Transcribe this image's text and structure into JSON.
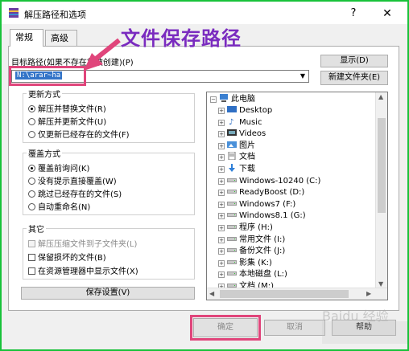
{
  "window": {
    "title": "解压路径和选项",
    "help": "?",
    "close": "✕"
  },
  "tabs": [
    {
      "label": "常规",
      "active": true
    },
    {
      "label": "高级",
      "active": false
    }
  ],
  "annotation": {
    "text": "文件保存路径",
    "color": "#7a2bbf",
    "highlight_color": "#e0457b"
  },
  "path": {
    "label": "目标路径(如果不存在将被创建)(P)",
    "value": "N:\\arar~ha",
    "show_button": "显示(D)",
    "new_folder_button": "新建文件夹(E)"
  },
  "update_mode": {
    "title": "更新方式",
    "options": [
      {
        "label": "解压并替换文件(R)",
        "selected": true
      },
      {
        "label": "解压并更新文件(U)",
        "selected": false
      },
      {
        "label": "仅更新已经存在的文件(F)",
        "selected": false
      }
    ]
  },
  "overwrite_mode": {
    "title": "覆盖方式",
    "options": [
      {
        "label": "覆盖前询问(K)",
        "selected": true
      },
      {
        "label": "没有提示直接覆盖(W)",
        "selected": false
      },
      {
        "label": "跳过已经存在的文件(S)",
        "selected": false
      },
      {
        "label": "自动重命名(N)",
        "selected": false
      }
    ]
  },
  "misc": {
    "title": "其它",
    "options": [
      {
        "label": "解压压缩文件到子文件夹(L)",
        "checked": false,
        "disabled": true
      },
      {
        "label": "保留损坏的文件(B)",
        "checked": false,
        "disabled": false
      },
      {
        "label": "在资源管理器中显示文件(X)",
        "checked": false,
        "disabled": false
      }
    ],
    "save_button": "保存设置(V)"
  },
  "tree": {
    "root": "此电脑",
    "items": [
      {
        "label": "Desktop",
        "icon": "desktop-folder-icon"
      },
      {
        "label": "Music",
        "icon": "music-icon"
      },
      {
        "label": "Videos",
        "icon": "video-folder-icon"
      },
      {
        "label": "图片",
        "icon": "pictures-folder-icon"
      },
      {
        "label": "文档",
        "icon": "documents-folder-icon"
      },
      {
        "label": "下载",
        "icon": "download-icon"
      },
      {
        "label": "Windows-10240 (C:)",
        "icon": "drive-icon"
      },
      {
        "label": "ReadyBoost (D:)",
        "icon": "drive-icon"
      },
      {
        "label": "Windows7 (F:)",
        "icon": "drive-icon"
      },
      {
        "label": "Windows8.1 (G:)",
        "icon": "drive-icon"
      },
      {
        "label": "程序 (H:)",
        "icon": "drive-icon"
      },
      {
        "label": "常用文件 (I:)",
        "icon": "drive-icon"
      },
      {
        "label": "备份文件 (J:)",
        "icon": "drive-icon"
      },
      {
        "label": "影集 (K:)",
        "icon": "drive-icon"
      },
      {
        "label": "本地磁盘 (L:)",
        "icon": "drive-icon"
      },
      {
        "label": "文档 (M:)",
        "icon": "drive-icon"
      }
    ]
  },
  "footer": {
    "ok": "确定",
    "cancel": "取消",
    "help": "帮助"
  },
  "watermark": "Baidu 经验"
}
